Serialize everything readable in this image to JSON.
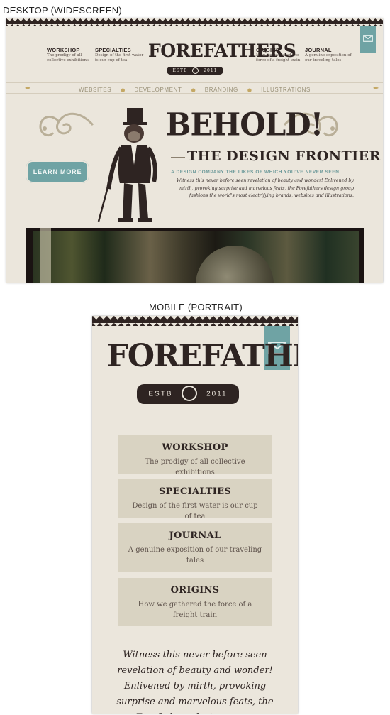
{
  "captions": {
    "desktop": "DESKTOP (WIDESCREEN)",
    "mobile": "MOBILE (PORTRAIT)"
  },
  "brand": {
    "name": "FOREFATHERS",
    "estb_label": "ESTB",
    "estb_year": "2011"
  },
  "nav": [
    {
      "title": "WORKSHOP",
      "desc": "The prodigy of all collective exhibitions"
    },
    {
      "title": "SPECIALTIES",
      "desc": "Design of the first water is our cup of tea"
    },
    {
      "title": "ORIGINS",
      "desc": "How we gathered the force of a freight train"
    },
    {
      "title": "JOURNAL",
      "desc": "A genuine exposition of our traveling tales"
    }
  ],
  "menu": [
    "WEBSITES",
    "DEVELOPMENT",
    "BRANDING",
    "ILLUSTRATIONS"
  ],
  "hero": {
    "headline": "BEHOLD!",
    "subheadline": "THE DESIGN FRONTIER",
    "tagline": "A DESIGN COMPANY THE LIKES OF WHICH YOU'VE NEVER SEEN",
    "blurb": "Witness this never before seen revelation of beauty and wonder! Enlivened by mirth, provoking surprise and marvelous feats, the Forefathers design group fashions the world's most electrifying brands, websites and illustrations.",
    "cta": "LEARN MORE"
  },
  "mobile": {
    "cards": [
      {
        "title": "WORKSHOP",
        "desc": "The prodigy of all collective exhibitions"
      },
      {
        "title": "SPECIALTIES",
        "desc": "Design of the first water is our cup of tea"
      },
      {
        "title": "JOURNAL",
        "desc": "A genuine exposition of our traveling tales"
      },
      {
        "title": "ORIGINS",
        "desc": "How we gathered the force of a freight train"
      }
    ],
    "blurb": "Witness this never before seen revelation of beauty and wonder! Enlivened by mirth, provoking surprise and marvelous feats, the Forefathers design group"
  },
  "icons": {
    "mail": "envelope-icon",
    "monkey": "monkey-illustration",
    "eye": "eye-icon"
  },
  "colors": {
    "paper": "#ebe6dc",
    "ink": "#2e2422",
    "teal": "#6fa3a4",
    "card": "#d9d3c2",
    "gold": "#c4a865"
  }
}
